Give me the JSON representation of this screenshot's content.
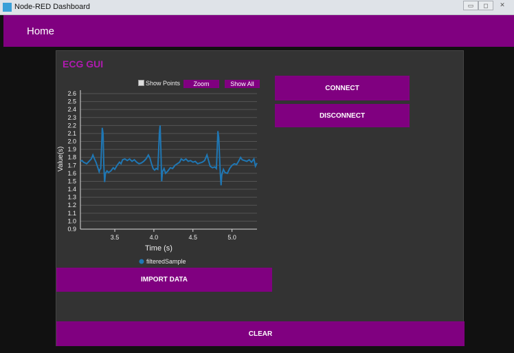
{
  "window": {
    "title": "Node-RED Dashboard",
    "minimize": "▭",
    "maximize": "◻",
    "close": "✕"
  },
  "header": {
    "title": "Home"
  },
  "card": {
    "title": "ECG GUI"
  },
  "chart_controls": {
    "show_points": "Show Points",
    "show_points_checked": false,
    "zoom": "Zoom",
    "show_all": "Show All"
  },
  "buttons": {
    "connect": "CONNECT",
    "disconnect": "DISCONNECT",
    "import": "IMPORT DATA",
    "clear": "CLEAR"
  },
  "colors": {
    "accent": "#800080",
    "line": "#1f77b4"
  },
  "chart_data": {
    "type": "line",
    "xlabel": "Time (s)",
    "ylabel": "Value(s)",
    "xlim": [
      3.06,
      5.32
    ],
    "ylim": [
      0.9,
      2.6
    ],
    "xticks": [
      3.5,
      4.0,
      4.5,
      5.0
    ],
    "yticks": [
      0.9,
      1.0,
      1.1,
      1.2,
      1.3,
      1.4,
      1.5,
      1.6,
      1.7,
      1.8,
      1.9,
      2.0,
      2.1,
      2.2,
      2.3,
      2.4,
      2.5,
      2.6
    ],
    "grid": true,
    "legend": "bottom",
    "series": [
      {
        "name": "filteredSample",
        "points": [
          [
            3.06,
            1.75
          ],
          [
            3.08,
            1.76
          ],
          [
            3.1,
            1.74
          ],
          [
            3.12,
            1.73
          ],
          [
            3.14,
            1.72
          ],
          [
            3.16,
            1.74
          ],
          [
            3.18,
            1.76
          ],
          [
            3.2,
            1.78
          ],
          [
            3.22,
            1.83
          ],
          [
            3.24,
            1.78
          ],
          [
            3.26,
            1.74
          ],
          [
            3.28,
            1.68
          ],
          [
            3.3,
            1.62
          ],
          [
            3.31,
            1.65
          ],
          [
            3.32,
            1.66
          ],
          [
            3.33,
            1.9
          ],
          [
            3.34,
            2.17
          ],
          [
            3.35,
            2.1
          ],
          [
            3.36,
            1.7
          ],
          [
            3.37,
            1.49
          ],
          [
            3.38,
            1.6
          ],
          [
            3.4,
            1.63
          ],
          [
            3.42,
            1.61
          ],
          [
            3.45,
            1.63
          ],
          [
            3.48,
            1.67
          ],
          [
            3.5,
            1.65
          ],
          [
            3.53,
            1.7
          ],
          [
            3.56,
            1.74
          ],
          [
            3.58,
            1.72
          ],
          [
            3.6,
            1.77
          ],
          [
            3.63,
            1.78
          ],
          [
            3.66,
            1.76
          ],
          [
            3.69,
            1.78
          ],
          [
            3.72,
            1.75
          ],
          [
            3.75,
            1.77
          ],
          [
            3.78,
            1.74
          ],
          [
            3.81,
            1.72
          ],
          [
            3.84,
            1.73
          ],
          [
            3.87,
            1.75
          ],
          [
            3.9,
            1.78
          ],
          [
            3.93,
            1.83
          ],
          [
            3.95,
            1.79
          ],
          [
            3.97,
            1.72
          ],
          [
            3.99,
            1.66
          ],
          [
            4.01,
            1.64
          ],
          [
            4.03,
            1.66
          ],
          [
            4.05,
            1.65
          ],
          [
            4.06,
            1.85
          ],
          [
            4.07,
            2.1
          ],
          [
            4.08,
            2.2
          ],
          [
            4.09,
            1.9
          ],
          [
            4.1,
            1.5
          ],
          [
            4.11,
            1.62
          ],
          [
            4.13,
            1.66
          ],
          [
            4.15,
            1.6
          ],
          [
            4.18,
            1.63
          ],
          [
            4.21,
            1.67
          ],
          [
            4.24,
            1.66
          ],
          [
            4.27,
            1.7
          ],
          [
            4.3,
            1.72
          ],
          [
            4.33,
            1.74
          ],
          [
            4.35,
            1.78
          ],
          [
            4.38,
            1.76
          ],
          [
            4.41,
            1.78
          ],
          [
            4.44,
            1.75
          ],
          [
            4.47,
            1.76
          ],
          [
            4.5,
            1.74
          ],
          [
            4.53,
            1.75
          ],
          [
            4.56,
            1.72
          ],
          [
            4.59,
            1.73
          ],
          [
            4.62,
            1.74
          ],
          [
            4.65,
            1.76
          ],
          [
            4.68,
            1.83
          ],
          [
            4.7,
            1.76
          ],
          [
            4.72,
            1.69
          ],
          [
            4.75,
            1.67
          ],
          [
            4.78,
            1.68
          ],
          [
            4.8,
            1.66
          ],
          [
            4.81,
            1.88
          ],
          [
            4.82,
            2.13
          ],
          [
            4.83,
            2.05
          ],
          [
            4.85,
            1.6
          ],
          [
            4.86,
            1.45
          ],
          [
            4.87,
            1.58
          ],
          [
            4.89,
            1.65
          ],
          [
            4.91,
            1.61
          ],
          [
            4.94,
            1.6
          ],
          [
            4.97,
            1.66
          ],
          [
            5.0,
            1.7
          ],
          [
            5.03,
            1.72
          ],
          [
            5.06,
            1.71
          ],
          [
            5.09,
            1.76
          ],
          [
            5.11,
            1.8
          ],
          [
            5.13,
            1.77
          ],
          [
            5.16,
            1.76
          ],
          [
            5.19,
            1.75
          ],
          [
            5.22,
            1.77
          ],
          [
            5.25,
            1.74
          ],
          [
            5.28,
            1.78
          ],
          [
            5.3,
            1.69
          ],
          [
            5.32,
            1.73
          ]
        ]
      }
    ]
  }
}
